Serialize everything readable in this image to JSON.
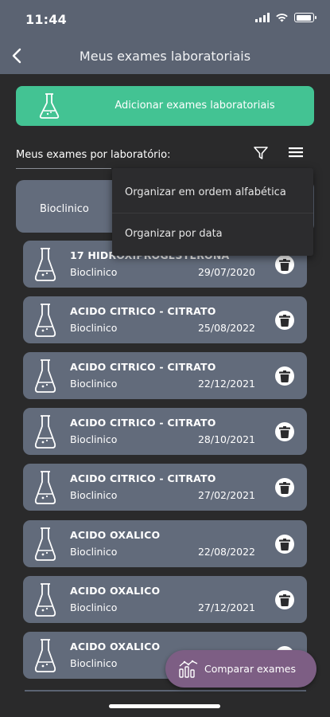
{
  "status_bar": {
    "time": "11:44"
  },
  "header": {
    "title": "Meus exames laboratoriais"
  },
  "add_button": {
    "label": "Adicionar exames laboratoriais"
  },
  "section": {
    "label": "Meus exames por laboratório:"
  },
  "lab_group": {
    "name": "Bioclinico"
  },
  "sort_menu": {
    "items": [
      "Organizar em ordem alfabética",
      "Organizar por data"
    ]
  },
  "exams": [
    {
      "title": "17 HIDROXIPROGESTERONA",
      "lab": "Bioclinico",
      "date": "29/07/2020"
    },
    {
      "title": "ACIDO CITRICO - CITRATO",
      "lab": "Bioclinico",
      "date": "25/08/2022"
    },
    {
      "title": "ACIDO CITRICO - CITRATO",
      "lab": "Bioclinico",
      "date": "22/12/2021"
    },
    {
      "title": "ACIDO CITRICO - CITRATO",
      "lab": "Bioclinico",
      "date": "28/10/2021"
    },
    {
      "title": "ACIDO CITRICO - CITRATO",
      "lab": "Bioclinico",
      "date": "27/02/2021"
    },
    {
      "title": "ACIDO OXALICO",
      "lab": "Bioclinico",
      "date": "22/08/2022"
    },
    {
      "title": "ACIDO OXALICO",
      "lab": "Bioclinico",
      "date": "27/12/2021"
    },
    {
      "title": "ACIDO OXALICO",
      "lab": "Bioclinico",
      "date": ""
    }
  ],
  "fab": {
    "label": "Comparar exames"
  },
  "colors": {
    "header_bg": "#5b6372",
    "accent_green": "#43c393",
    "card_bg": "#626b7b",
    "background": "#2a2a2b",
    "fab_purple": "#7d5e84"
  }
}
